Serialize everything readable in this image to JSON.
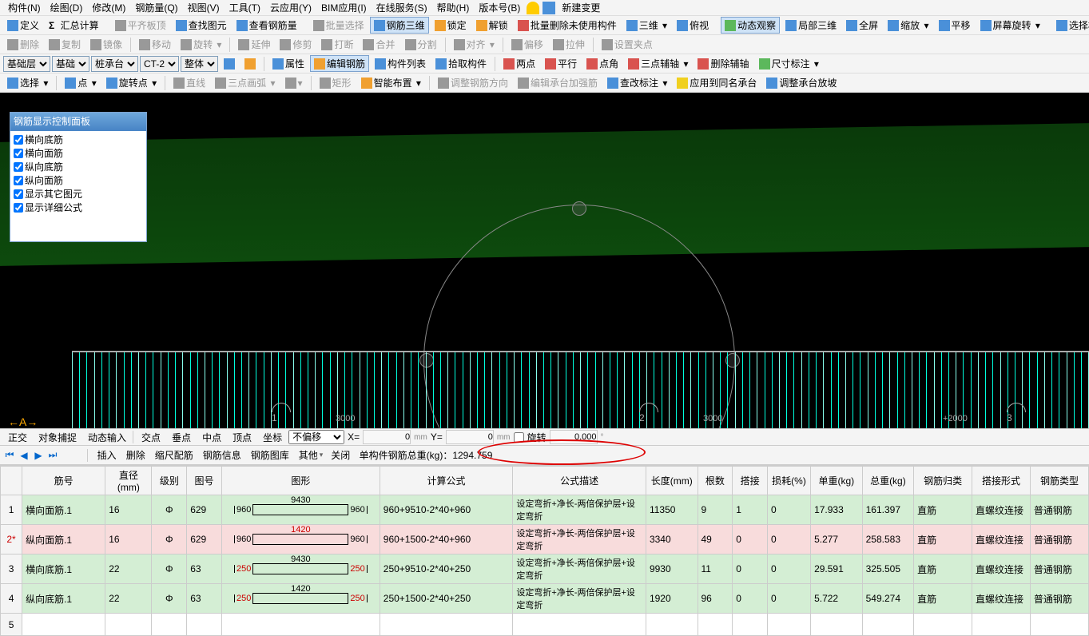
{
  "menu": {
    "items": [
      "构件(N)",
      "绘图(D)",
      "修改(M)",
      "钢筋量(Q)",
      "视图(V)",
      "工具(T)",
      "云应用(Y)",
      "BIM应用(I)",
      "在线服务(S)",
      "帮助(H)",
      "版本号(B)"
    ],
    "new_change": "新建变更"
  },
  "tb1": {
    "define": "定义",
    "sum": "汇总计算",
    "align_board": "平齐板顶",
    "find_elem": "查找图元",
    "view_rebar": "查看钢筋量",
    "batch_sel": "批量选择",
    "rebar_3d": "钢筋三维",
    "lock": "锁定",
    "unlock": "解锁",
    "batch_del": "批量删除未使用构件",
    "view_3d": "三维",
    "top_view": "俯视",
    "dyn_obs": "动态观察",
    "local_3d": "局部三维",
    "fullscreen": "全屏",
    "zoom": "缩放",
    "pan": "平移",
    "screen_rot": "屏幕旋转",
    "sel_same": "选择相"
  },
  "tb2": {
    "delete": "删除",
    "copy": "复制",
    "mirror": "镜像",
    "move": "移动",
    "rotate": "旋转",
    "extend": "延伸",
    "trim": "修剪",
    "break": "打断",
    "merge": "合并",
    "split": "分割",
    "align": "对齐",
    "offset": "偏移",
    "stretch": "拉伸",
    "set_clamp": "设置夹点"
  },
  "tb3": {
    "layer1": "基础层",
    "layer2": "基础",
    "layer3": "桩承台",
    "layer4": "CT-2",
    "layer5": "整体",
    "props": "属性",
    "edit_rebar": "编辑钢筋",
    "comp_list": "构件列表",
    "pick_comp": "拾取构件",
    "two_pt": "两点",
    "parallel": "平行",
    "pt_angle": "点角",
    "three_pt": "三点辅轴",
    "del_aux": "删除辅轴",
    "dim_annot": "尺寸标注"
  },
  "tb4": {
    "select": "选择",
    "point": "点",
    "rotate_pt": "旋转点",
    "line": "直线",
    "arc3": "三点画弧",
    "rect": "矩形",
    "smart": "智能布置",
    "adj_rebar": "调整钢筋方向",
    "edit_cap": "编辑承台加强筋",
    "check_annot": "查改标注",
    "apply_same": "应用到同名承台",
    "adj_cap": "调整承台放坡"
  },
  "panel": {
    "title": "钢筋显示控制面板",
    "items": [
      "横向底筋",
      "横向面筋",
      "纵向底筋",
      "纵向面筋",
      "显示其它图元",
      "显示详细公式"
    ]
  },
  "canvas": {
    "markers": [
      "3000",
      "3000",
      "+2000"
    ],
    "marker_nums": [
      "1",
      "2",
      "3"
    ]
  },
  "status": {
    "ortho": "正交",
    "snap": "对象捕捉",
    "dyn_input": "动态输入",
    "inter": "交点",
    "perp": "垂点",
    "mid": "中点",
    "apex": "顶点",
    "coord": "坐标",
    "offset_mode": "不偏移",
    "x_label": "X=",
    "x_val": "0",
    "y_label": "Y=",
    "y_val": "0",
    "rotate": "旋转",
    "rot_val": "0.000",
    "unit_mm": "mm",
    "unit_deg": "°"
  },
  "grid_tb": {
    "insert": "插入",
    "delete": "删除",
    "scale_match": "缩尺配筋",
    "rebar_info": "钢筋信息",
    "rebar_lib": "钢筋图库",
    "other": "其他",
    "close": "关闭",
    "total_weight_label": "单构件钢筋总重(kg)：",
    "total_weight": "1294.759"
  },
  "table": {
    "headers": [
      "",
      "筋号",
      "直径(mm)",
      "级别",
      "图号",
      "图形",
      "计算公式",
      "公式描述",
      "长度(mm)",
      "根数",
      "搭接",
      "损耗(%)",
      "单重(kg)",
      "总重(kg)",
      "钢筋归类",
      "搭接形式",
      "钢筋类型"
    ],
    "rows": [
      {
        "n": "1",
        "id": "横向面筋.1",
        "dia": "16",
        "lvl": "Φ",
        "pic": "629",
        "sh_l": "960",
        "sh_m": "9430",
        "sh_w": 120,
        "sh_r": "960",
        "red": false,
        "formula": "960+9510-2*40+960",
        "desc": "设定弯折+净长-两倍保护层+设定弯折",
        "len": "11350",
        "cnt": "9",
        "lap": "1",
        "loss": "0",
        "uw": "17.933",
        "tw": "161.397",
        "cat": "直筋",
        "lf": "直螺纹连接",
        "rt": "普通钢筋"
      },
      {
        "n": "2*",
        "id": "纵向面筋.1",
        "dia": "16",
        "lvl": "Φ",
        "pic": "629",
        "sh_l": "960",
        "sh_m": "1420",
        "sh_w": 120,
        "sh_r": "960",
        "red": true,
        "formula": "960+1500-2*40+960",
        "desc": "设定弯折+净长-两倍保护层+设定弯折",
        "len": "3340",
        "cnt": "49",
        "lap": "0",
        "loss": "0",
        "uw": "5.277",
        "tw": "258.583",
        "cat": "直筋",
        "lf": "直螺纹连接",
        "rt": "普通钢筋",
        "sel": true
      },
      {
        "n": "3",
        "id": "横向底筋.1",
        "dia": "22",
        "lvl": "Φ",
        "pic": "63",
        "sh_l": "250",
        "sh_m": "9430",
        "sh_w": 120,
        "sh_r": "250",
        "red": false,
        "lred": true,
        "formula": "250+9510-2*40+250",
        "desc": "设定弯折+净长-两倍保护层+设定弯折",
        "len": "9930",
        "cnt": "11",
        "lap": "0",
        "loss": "0",
        "uw": "29.591",
        "tw": "325.505",
        "cat": "直筋",
        "lf": "直螺纹连接",
        "rt": "普通钢筋"
      },
      {
        "n": "4",
        "id": "纵向底筋.1",
        "dia": "22",
        "lvl": "Φ",
        "pic": "63",
        "sh_l": "250",
        "sh_m": "1420",
        "sh_w": 120,
        "sh_r": "250",
        "red": false,
        "lred": true,
        "formula": "250+1500-2*40+250",
        "desc": "设定弯折+净长-两倍保护层+设定弯折",
        "len": "1920",
        "cnt": "96",
        "lap": "0",
        "loss": "0",
        "uw": "5.722",
        "tw": "549.274",
        "cat": "直筋",
        "lf": "直螺纹连接",
        "rt": "普通钢筋"
      },
      {
        "n": "5",
        "empty": true
      }
    ]
  }
}
